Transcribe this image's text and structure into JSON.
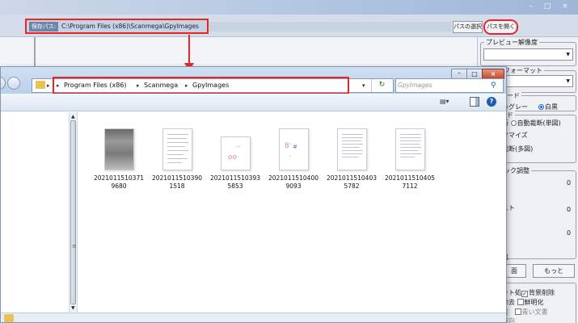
{
  "app": {
    "path_label": "保存パス:",
    "path_value": "C:\\Program Files (x86)\\Scanmega\\GpyImages",
    "path_select_button": "パスの選択",
    "path_open_button": "パスを開く",
    "window_buttons": {
      "minimize": "–",
      "maximize": "□",
      "close": "×"
    }
  },
  "right_panel": {
    "preview_resolution": {
      "title": "プレビュー解像度"
    },
    "format": {
      "title": "フォーマット"
    },
    "color_mode": {
      "title": "ード",
      "options": [
        {
          "label": "グレー",
          "selected": false
        },
        {
          "label": "白黒",
          "selected": true
        }
      ]
    },
    "crop": {
      "title": "ド",
      "row1_prefix": "断",
      "row1_option": "自動裁断(単図)",
      "row2": "タマイズ",
      "row3": "裁断(多図)"
    },
    "adjust": {
      "title": "ック調整",
      "value1": "0",
      "row2_label": "スト",
      "value2": "0",
      "value3": "0"
    },
    "output": {
      "label1": "出",
      "label2": "面",
      "more_button": "もっと"
    },
    "options": {
      "items": [
        {
          "prefix": "ット処",
          "checkbox": "背景削除",
          "checked": true
        },
        {
          "prefix": "除去",
          "checkbox": "鮮明化",
          "checked": false
        },
        {
          "prefix": "書",
          "checkbox": "青い文書",
          "checked": false
        },
        {
          "prefix": "方向",
          "checkbox": "",
          "checked": false
        }
      ]
    }
  },
  "explorer": {
    "breadcrumb": [
      "Program Files (x86)",
      "Scanmega",
      "GpyImages"
    ],
    "search_placeholder": "GpyImages",
    "files": [
      {
        "name_line1": "2021011510371",
        "name_line2": "9680",
        "thumb": "dark"
      },
      {
        "name_line1": "2021011510390",
        "name_line2": "1518",
        "thumb": "text"
      },
      {
        "name_line1": "2021011510393",
        "name_line2": "5853",
        "thumb": "dots-pink"
      },
      {
        "name_line1": "2021011510400",
        "name_line2": "9093",
        "thumb": "pink-dots"
      },
      {
        "name_line1": "2021011510403",
        "name_line2": "5782",
        "thumb": "text"
      },
      {
        "name_line1": "2021011510405",
        "name_line2": "7112",
        "thumb": "text"
      }
    ]
  },
  "colors": {
    "highlight_red": "#e8262a",
    "selected_radio": "#1d63c9",
    "folder_yellow": "#e9c355"
  }
}
